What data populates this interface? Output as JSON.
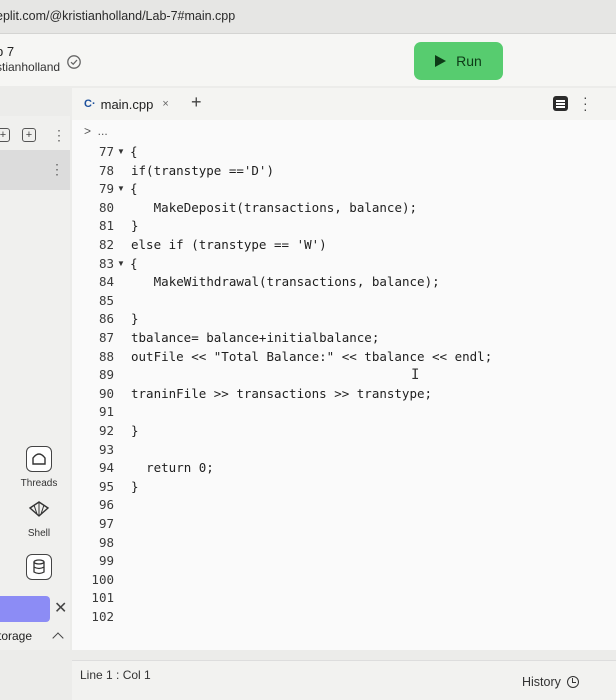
{
  "browser": {
    "url": "eplit.com/@kristianholland/Lab-7#main.cpp"
  },
  "header": {
    "repl_number": "b 7",
    "owner": "stianholland",
    "run_label": "Run"
  },
  "editor": {
    "tab_label": "main.cpp",
    "tab_lang": "C·",
    "tab_close": "×",
    "add_tab": "+",
    "breadcrumb": ">  ...",
    "lines": [
      {
        "n": "77",
        "fold": true,
        "text": "{",
        "indent": 0
      },
      {
        "n": "78",
        "fold": false,
        "text": "if(transtype =='D')",
        "indent": 0
      },
      {
        "n": "79",
        "fold": true,
        "text": "{",
        "indent": 0
      },
      {
        "n": "80",
        "fold": false,
        "text": "MakeDeposit(transactions, balance);",
        "indent": 3
      },
      {
        "n": "81",
        "fold": false,
        "text": "}",
        "indent": 0
      },
      {
        "n": "82",
        "fold": false,
        "text": "else if (transtype == 'W')",
        "indent": 0
      },
      {
        "n": "83",
        "fold": true,
        "text": "{",
        "indent": 0
      },
      {
        "n": "84",
        "fold": false,
        "text": "MakeWithdrawal(transactions, balance);",
        "indent": 3
      },
      {
        "n": "85",
        "fold": false,
        "text": "",
        "indent": 0
      },
      {
        "n": "86",
        "fold": false,
        "text": "}",
        "indent": 0
      },
      {
        "n": "87",
        "fold": false,
        "text": "tbalance= balance+initialbalance;",
        "indent": 0
      },
      {
        "n": "88",
        "fold": false,
        "text": "outFile << \"Total Balance:\" << tbalance << endl;",
        "indent": 0
      },
      {
        "n": "89",
        "fold": false,
        "text": "",
        "indent": 0
      },
      {
        "n": "90",
        "fold": false,
        "text": "traninFile >> transactions >> transtype;",
        "indent": 0
      },
      {
        "n": "91",
        "fold": false,
        "text": "",
        "indent": 0
      },
      {
        "n": "92",
        "fold": false,
        "text": "}",
        "indent": 0
      },
      {
        "n": "93",
        "fold": false,
        "text": "",
        "indent": 0
      },
      {
        "n": "94",
        "fold": false,
        "text": "return 0;",
        "indent": 2
      },
      {
        "n": "95",
        "fold": false,
        "text": "}",
        "indent": 0
      },
      {
        "n": "96",
        "fold": false,
        "text": "",
        "indent": 0
      },
      {
        "n": "97",
        "fold": false,
        "text": "",
        "indent": 0
      },
      {
        "n": "98",
        "fold": false,
        "text": "",
        "indent": 0
      },
      {
        "n": "99",
        "fold": false,
        "text": "",
        "indent": 0
      },
      {
        "n": "100",
        "fold": false,
        "text": "",
        "indent": 0
      },
      {
        "n": "101",
        "fold": false,
        "text": "",
        "indent": 0
      },
      {
        "n": "102",
        "fold": false,
        "text": "",
        "indent": 0
      }
    ]
  },
  "sidebar": {
    "threads_label": "Threads",
    "shell_label": "Shell",
    "storage_label": "torage"
  },
  "status": {
    "position": "Line 1 : Col 1",
    "history_label": "History"
  }
}
